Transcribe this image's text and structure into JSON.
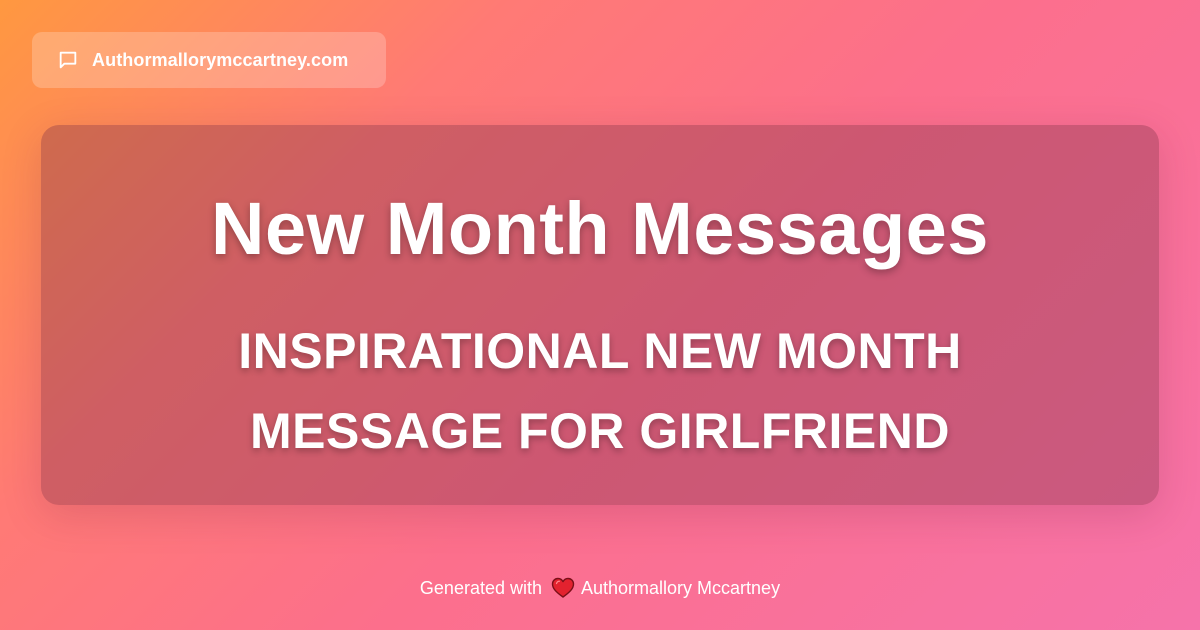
{
  "header": {
    "site_name": "Authormallorymccartney.com",
    "icon": "chat-bubble-icon"
  },
  "card": {
    "title": "New Month Messages",
    "subtitle_line1": "INSPIRATIONAL NEW MONTH",
    "subtitle_line2": "MESSAGE FOR GIRLFRIEND"
  },
  "footer": {
    "prefix": "Generated with",
    "icon": "heart-icon",
    "author": "Authormallory Mccartney"
  },
  "colors": {
    "gradient_start": "#ff9840",
    "gradient_mid": "#fc6f8c",
    "gradient_end": "#f673aa",
    "heart": "#e3222f",
    "text": "#ffffff"
  }
}
